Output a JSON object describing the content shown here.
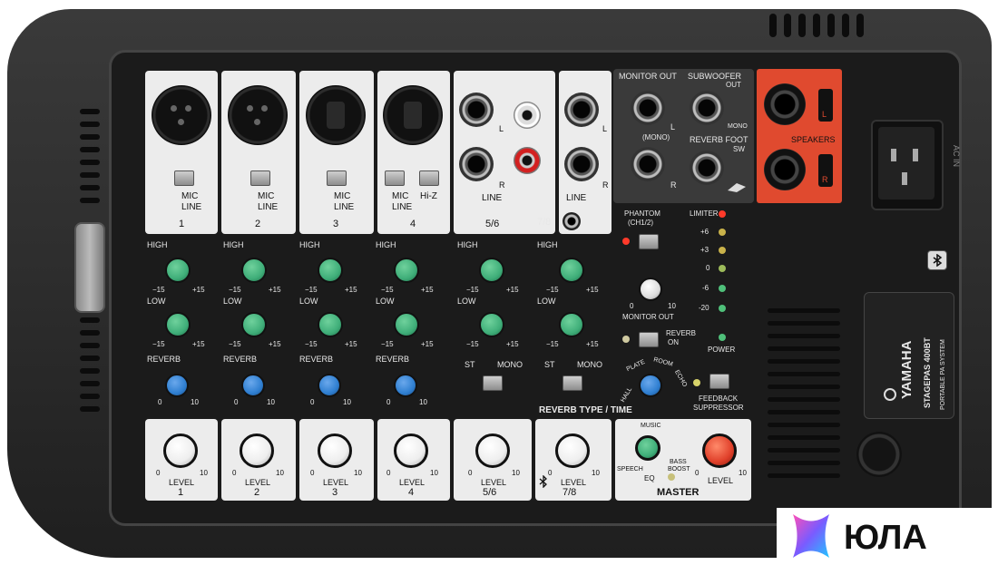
{
  "channels": [
    {
      "number": "1",
      "switch_top": "MIC",
      "switch_bottom": "LINE"
    },
    {
      "number": "2",
      "switch_top": "MIC",
      "switch_bottom": "LINE"
    },
    {
      "number": "3",
      "switch_top": "MIC",
      "switch_bottom": "LINE"
    },
    {
      "number": "4",
      "switch_top": "MIC",
      "switch_bottom": "LINE",
      "hiz": "Hi-Z"
    }
  ],
  "stereo_channels": [
    {
      "number": "5/6",
      "input_label": "LINE",
      "st": "ST",
      "mono": "MONO"
    },
    {
      "number": "7/8",
      "input_label": "LINE",
      "st": "ST",
      "mono": "MONO"
    }
  ],
  "jack_labels": {
    "left": "L",
    "right": "R"
  },
  "eq": {
    "high": "HIGH",
    "low": "LOW",
    "reverb": "REVERB",
    "min": "−15",
    "max": "+15",
    "zero": "0",
    "ten": "10"
  },
  "level": {
    "label": "LEVEL",
    "min": "0",
    "max": "10"
  },
  "reverb_type": "REVERB TYPE / TIME",
  "reverb_types": {
    "hall": "HALL",
    "plate": "PLATE",
    "room": "ROOM",
    "echo": "ECHO"
  },
  "outputs": {
    "monitor_out": "MONITOR OUT",
    "mono": "(MONO)",
    "subwoofer": "SUBWOOFER",
    "out": "OUT",
    "mono_small": "MONO",
    "reverb_foot": "REVERB FOOT",
    "sw": "SW",
    "speakers": "SPEAKERS",
    "spk_l": "L",
    "spk_r": "R"
  },
  "phantom": {
    "line1": "PHANTOM",
    "line2": "(CH1/2)"
  },
  "monitor_out_knob": "MONITOR OUT",
  "reverb_on": {
    "line1": "REVERB",
    "line2": "ON"
  },
  "feedback": {
    "line1": "FEEDBACK",
    "line2": "SUPPRESSOR"
  },
  "meter": {
    "limiter": "LIMITER",
    "levels": [
      "+6",
      "+3",
      "0",
      "-6",
      "-20"
    ],
    "power": "POWER"
  },
  "master": {
    "title": "MASTER",
    "eq": "EQ",
    "music": "MUSIC",
    "speech": "SPEECH",
    "bass_boost_1": "BASS",
    "bass_boost_2": "BOOST",
    "level": "LEVEL"
  },
  "ac_in": "AC IN",
  "brand": {
    "name": "YAMAHA",
    "model": "STAGEPAS 400BT",
    "subtitle": "PORTABLE PA SYSTEM"
  },
  "watermark": "ЮЛА",
  "colors": {
    "hi_knob": "#3fae79",
    "reverb_knob": "#2f7fd1",
    "level_knob": "#ffffff",
    "master_knob": "#e0402a",
    "speaker_panel": "#e04a2f"
  }
}
